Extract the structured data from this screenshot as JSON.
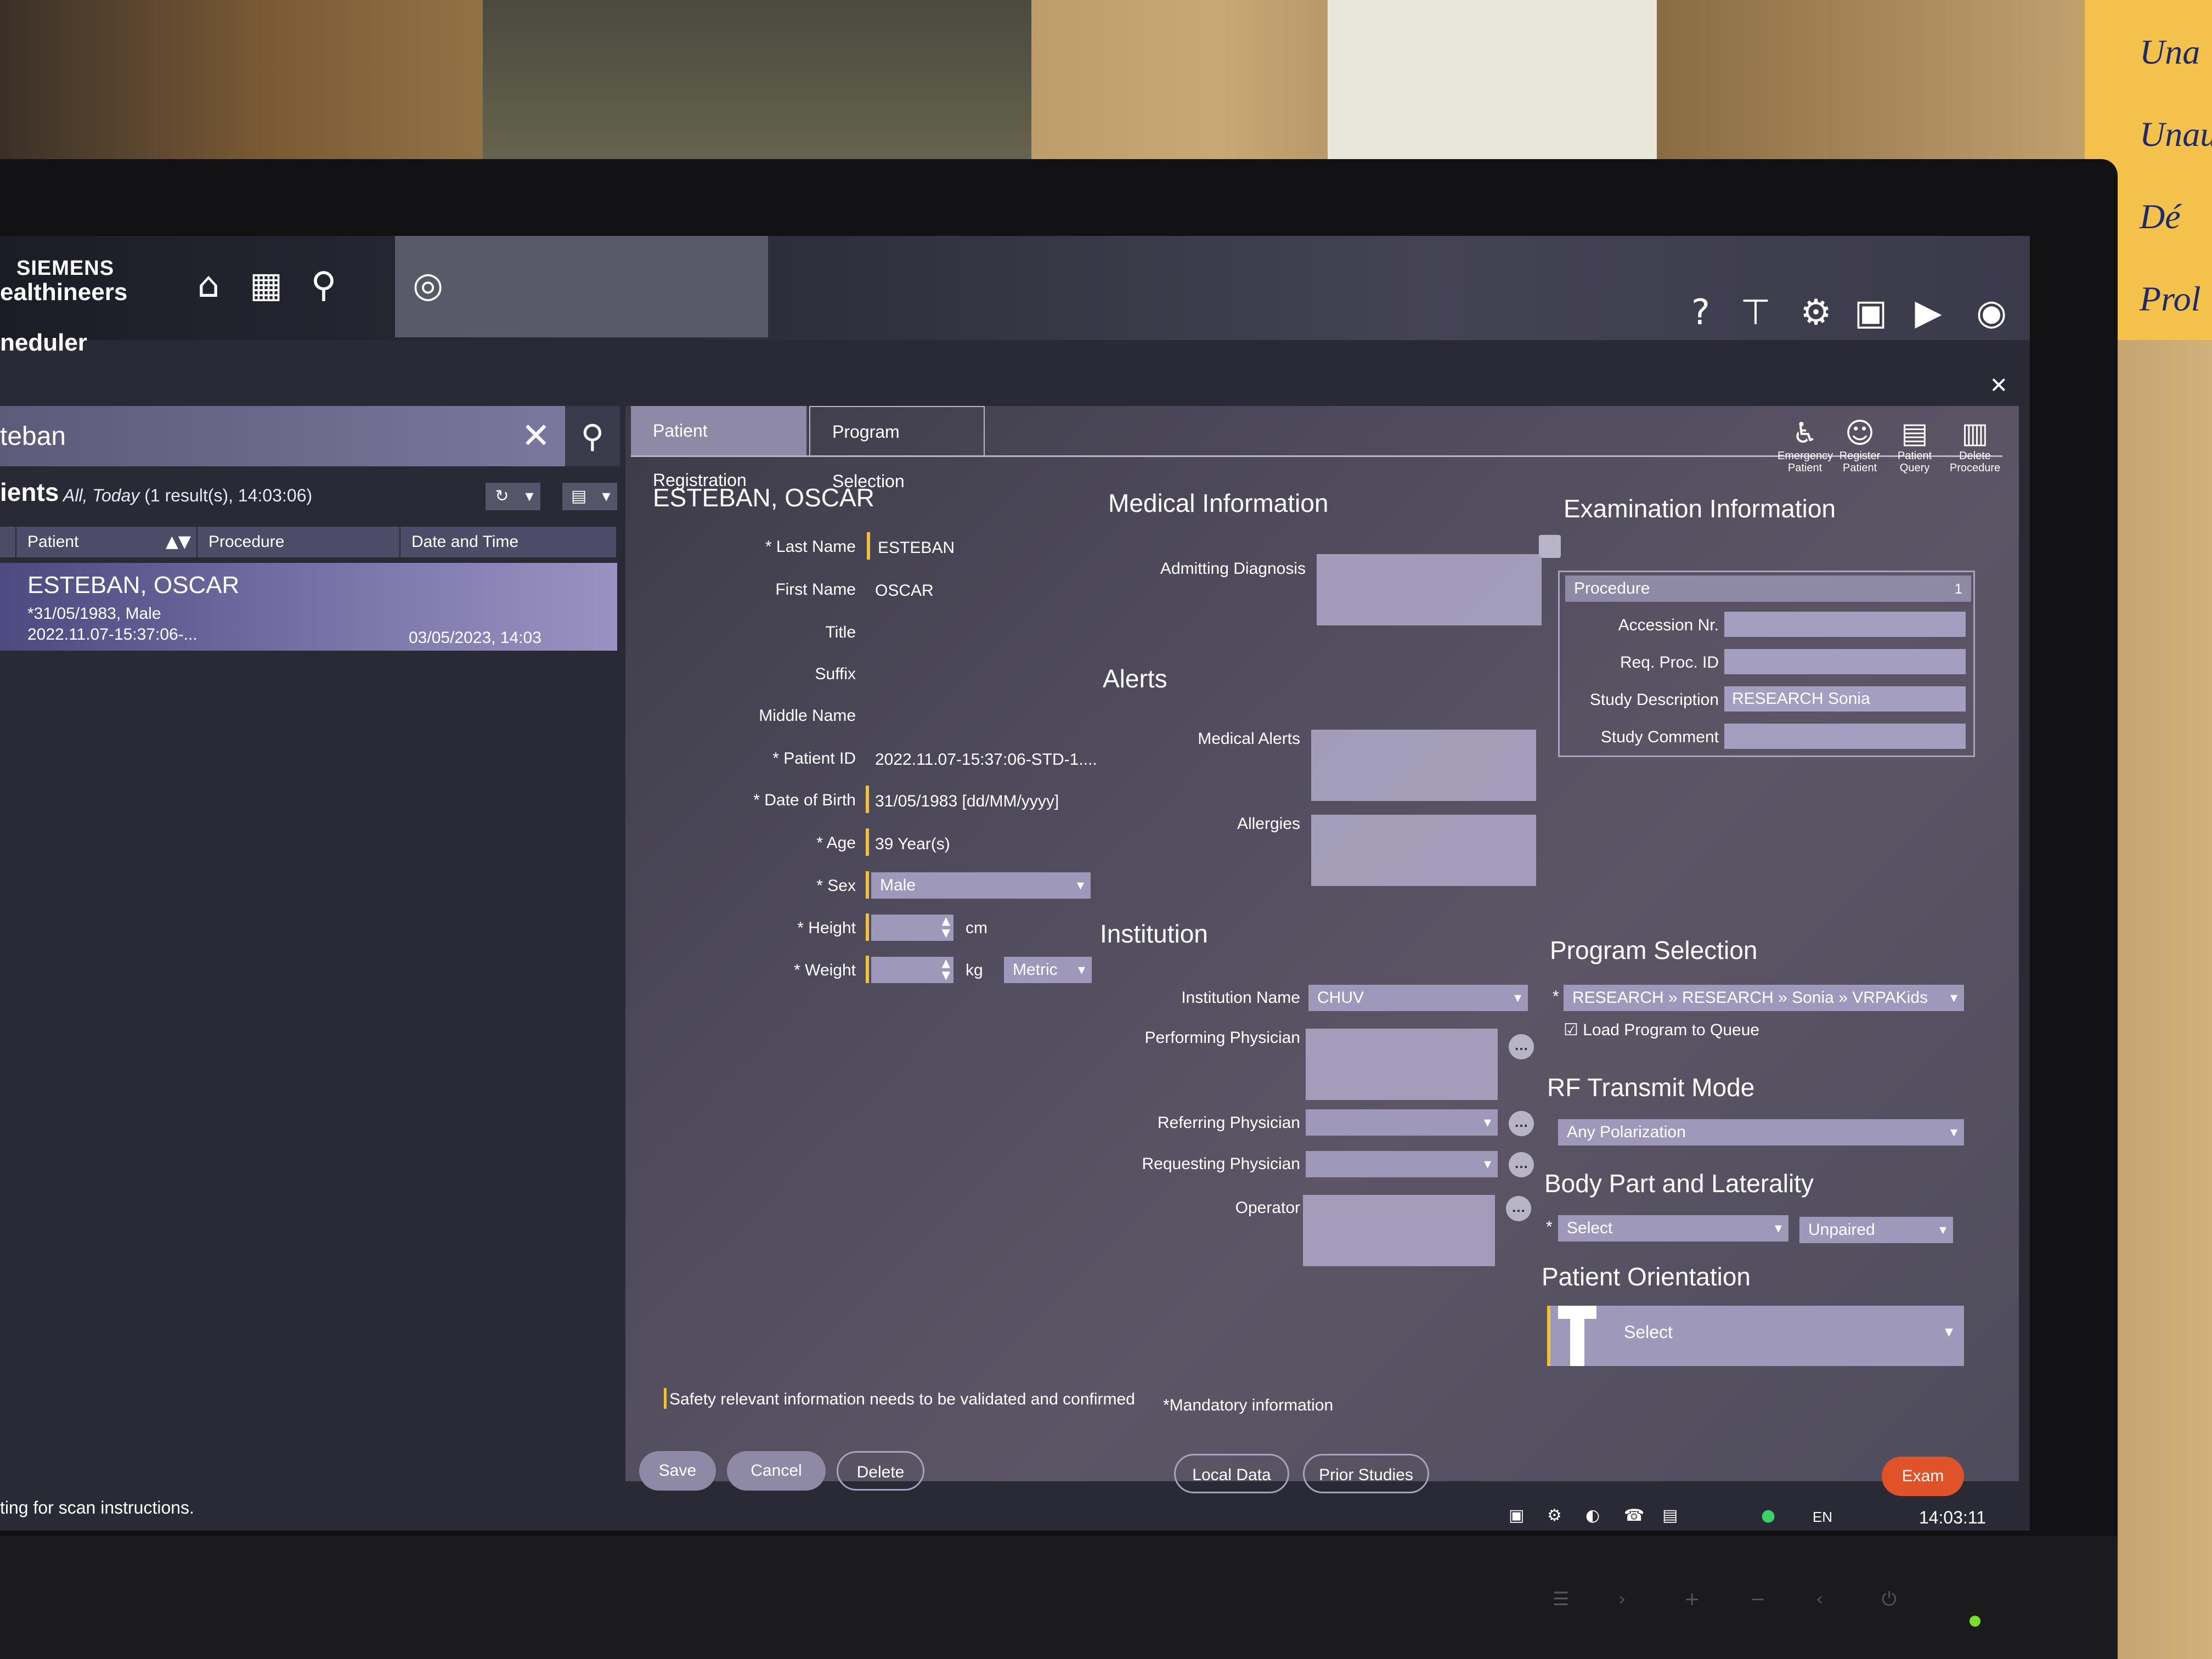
{
  "header": {
    "brand_line1": "SIEMENS",
    "brand_line2": "ealthineers",
    "app_title": "neduler"
  },
  "search": {
    "value": "teban"
  },
  "patient_list": {
    "title": "ients",
    "filter_italic": "All, Today",
    "filter_rest": "(1 result(s), 14:03:06)",
    "columns": [
      "Patient",
      "Procedure",
      "Date and Time"
    ],
    "selected_row": {
      "name": "ESTEBAN, OSCAR",
      "dob_sex": "*31/05/1983, Male",
      "id": "2022.11.07-15:37:06-...",
      "datetime": "03/05/2023, 14:03"
    }
  },
  "status_line": "ting for scan instructions.",
  "tabs": [
    "Patient Registration",
    "Program Selection"
  ],
  "toolbar": {
    "emergency": "Emergency Patient",
    "register": "Register Patient",
    "query": "Patient Query",
    "delete": "Delete Procedure"
  },
  "patient": {
    "heading": "ESTEBAN, OSCAR",
    "last_name_label": "Last Name",
    "last_name": "ESTEBAN",
    "first_name_label": "First Name",
    "first_name": "OSCAR",
    "title_label": "Title",
    "suffix_label": "Suffix",
    "middle_name_label": "Middle Name",
    "patient_id_label": "Patient ID",
    "patient_id": "2022.11.07-15:37:06-STD-1....",
    "dob_label": "Date of Birth",
    "dob": "31/05/1983",
    "dob_format": "[dd/MM/yyyy]",
    "age_label": "Age",
    "age": "39 Year(s)",
    "sex_label": "Sex",
    "sex": "Male",
    "height_label": "Height",
    "height_unit": "cm",
    "weight_label": "Weight",
    "weight_unit": "kg",
    "units": "Metric"
  },
  "medical": {
    "heading": "Medical Information",
    "admitting_label": "Admitting Diagnosis",
    "alerts_heading": "Alerts",
    "medical_alerts_label": "Medical Alerts",
    "allergies_label": "Allergies"
  },
  "institution": {
    "heading": "Institution",
    "name_label": "Institution Name",
    "name": "CHUV",
    "performing_label": "Performing Physician",
    "referring_label": "Referring Physician",
    "requesting_label": "Requesting Physician",
    "operator_label": "Operator"
  },
  "exam": {
    "heading": "Examination Information",
    "procedure_label": "Procedure",
    "procedure_num": "1",
    "accession_label": "Accession Nr.",
    "req_proc_label": "Req. Proc. ID",
    "study_desc_label": "Study Description",
    "study_desc": "RESEARCH Sonia",
    "study_comment_label": "Study Comment"
  },
  "program": {
    "heading": "Program Selection",
    "path": "RESEARCH » RESEARCH » Sonia » VRPAKids",
    "load_queue": "Load Program to Queue"
  },
  "rf": {
    "heading": "RF Transmit Mode",
    "value": "Any Polarization"
  },
  "body_part": {
    "heading": "Body Part and Laterality",
    "select": "Select",
    "laterality": "Unpaired"
  },
  "orientation": {
    "heading": "Patient Orientation",
    "select": "Select"
  },
  "footnotes": {
    "safety": "Safety relevant information needs to be validated and confirmed",
    "mandatory": "*Mandatory information"
  },
  "buttons": {
    "save": "Save",
    "cancel": "Cancel",
    "delete": "Delete",
    "local_data": "Local Data",
    "prior_studies": "Prior Studies",
    "exam": "Exam"
  },
  "taskbar": {
    "lang": "EN",
    "clock": "14:03:11"
  },
  "poster_text": [
    "Una",
    "Unau",
    "Dé",
    "Prol"
  ]
}
